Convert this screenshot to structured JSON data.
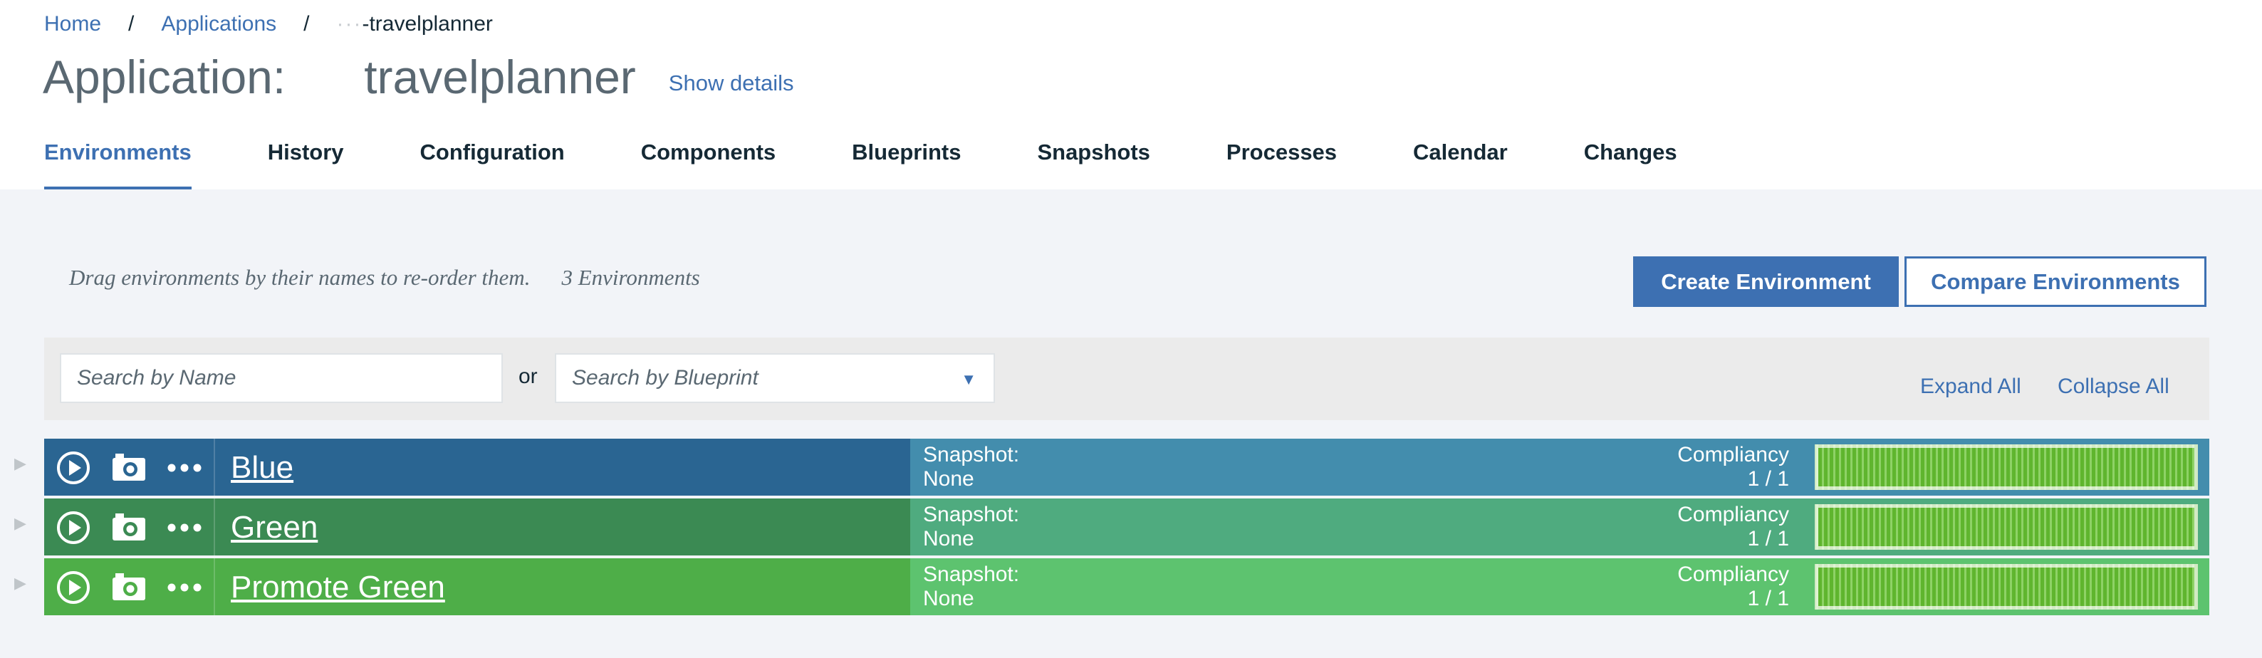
{
  "breadcrumb": {
    "home": "Home",
    "separator": "/",
    "applications": "Applications",
    "current_prefix": "···",
    "current": "-travelplanner"
  },
  "header": {
    "title_label": "Application:",
    "app_name": "travelplanner",
    "show_details": "Show details"
  },
  "tabs": [
    {
      "label": "Environments",
      "active": true
    },
    {
      "label": "History"
    },
    {
      "label": "Configuration"
    },
    {
      "label": "Components"
    },
    {
      "label": "Blueprints"
    },
    {
      "label": "Snapshots"
    },
    {
      "label": "Processes"
    },
    {
      "label": "Calendar"
    },
    {
      "label": "Changes"
    }
  ],
  "toolbar": {
    "hint": "Drag environments by their names to re-order them.",
    "env_count": "3 Environments",
    "create_label": "Create Environment",
    "compare_label": "Compare Environments"
  },
  "filters": {
    "name_placeholder": "Search by Name",
    "or_label": "or",
    "blueprint_placeholder": "Search by Blueprint",
    "expand_all": "Expand All",
    "collapse_all": "Collapse All"
  },
  "environments": [
    {
      "name": "Blue",
      "snapshot_label": "Snapshot:",
      "snapshot": "None",
      "compliancy_label": "Compliancy",
      "compliancy": "1 / 1",
      "compliancy_fraction": 1.0,
      "color_left": "#2a6592",
      "color_right": "#438dad"
    },
    {
      "name": "Green",
      "snapshot_label": "Snapshot:",
      "snapshot": "None",
      "compliancy_label": "Compliancy",
      "compliancy": "1 / 1",
      "compliancy_fraction": 1.0,
      "color_left": "#3b8a53",
      "color_right": "#4fab7f"
    },
    {
      "name": "Promote Green",
      "snapshot_label": "Snapshot:",
      "snapshot": "None",
      "compliancy_label": "Compliancy",
      "compliancy": "1 / 1",
      "compliancy_fraction": 1.0,
      "color_left": "#4eae48",
      "color_right": "#5dc36f"
    }
  ],
  "icons": {
    "run": "play-circle-icon",
    "snapshot": "camera-icon",
    "more": "more-dots-icon",
    "expand_row": "triangle-right-icon",
    "dropdown": "caret-down-icon"
  },
  "colors": {
    "accent": "#3d70b2",
    "content_bg": "#f2f4f8",
    "filter_bg": "#ebebeb",
    "compliancy_fill": "#5fb52e"
  }
}
